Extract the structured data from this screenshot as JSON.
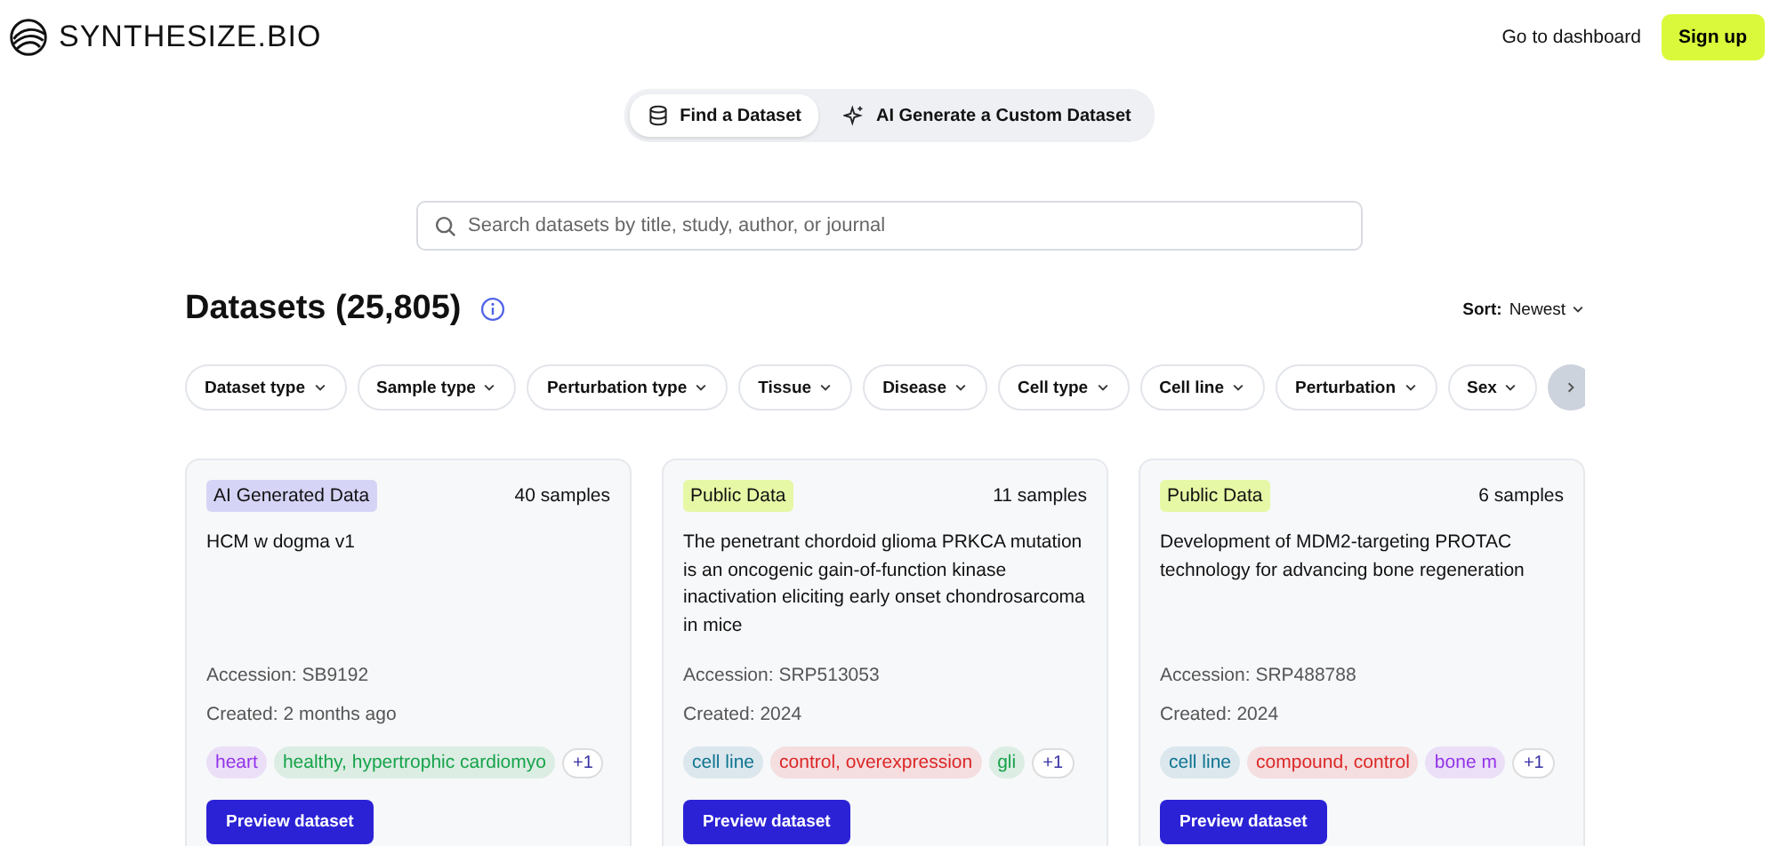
{
  "header": {
    "logo": "SYNTHESIZE.BIO",
    "dashboard_link": "Go to dashboard",
    "signup_button": "Sign up"
  },
  "tabs": [
    {
      "label": "Find a Dataset",
      "selected": true
    },
    {
      "label": "AI Generate a Custom Dataset",
      "selected": false
    }
  ],
  "search": {
    "placeholder": "Search datasets by title, study, author, or journal"
  },
  "heading": "Datasets (25,805)",
  "sort": {
    "label": "Sort:",
    "value": "Newest"
  },
  "filters": [
    "Dataset type",
    "Sample type",
    "Perturbation type",
    "Tissue",
    "Disease",
    "Cell type",
    "Cell line",
    "Perturbation",
    "Sex"
  ],
  "cards": [
    {
      "badge": "AI Generated Data",
      "kind": "ai",
      "samples": "40 samples",
      "title": "HCM w dogma v1",
      "accession": "Accession: SB9192",
      "created": "Created: 2 months ago",
      "tags": [
        {
          "label": "heart",
          "color": "#9333ea"
        },
        {
          "label": "healthy, hypertrophic cardiomyo",
          "color": "#16a34a"
        }
      ],
      "more": "+1",
      "button": "Preview dataset"
    },
    {
      "badge": "Public Data",
      "kind": "public",
      "samples": "11 samples",
      "title": "The penetrant chordoid glioma PRKCA mutation is an oncogenic gain-of-function kinase inactivation eliciting early onset chondrosarcoma in mice",
      "accession": "Accession: SRP513053",
      "created": "Created: 2024",
      "tags": [
        {
          "label": "cell line",
          "color": "#0e7490"
        },
        {
          "label": "control, overexpression",
          "color": "#dc2626"
        },
        {
          "label": "gli",
          "color": "#16a34a"
        }
      ],
      "more": "+1",
      "button": "Preview dataset"
    },
    {
      "badge": "Public Data",
      "kind": "public",
      "samples": "6 samples",
      "title": "Development of MDM2-targeting PROTAC technology for advancing bone regeneration",
      "accession": "Accession: SRP488788",
      "created": "Created: 2024",
      "tags": [
        {
          "label": "cell line",
          "color": "#0e7490"
        },
        {
          "label": "compound, control",
          "color": "#dc2626"
        },
        {
          "label": "bone m",
          "color": "#9333ea"
        }
      ],
      "more": "+1",
      "button": "Preview dataset"
    }
  ]
}
